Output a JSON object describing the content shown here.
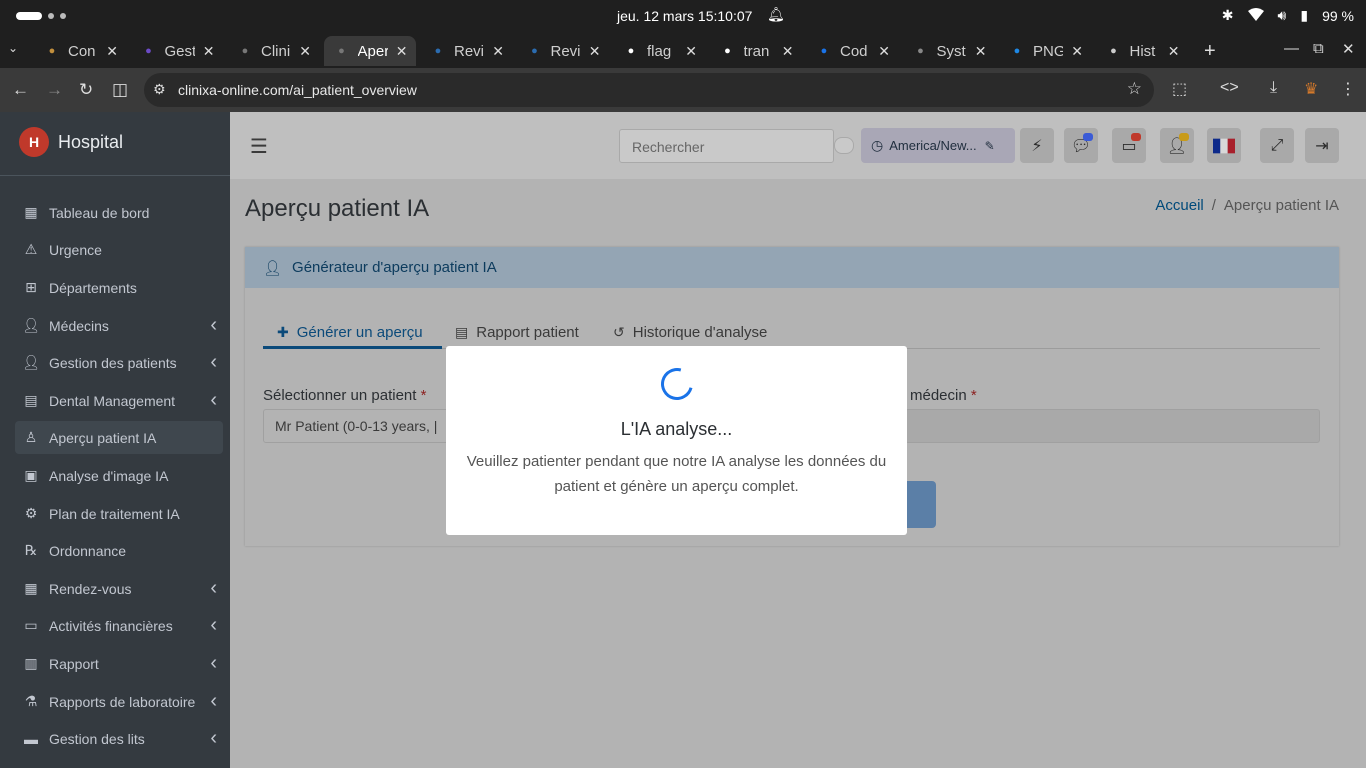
{
  "os": {
    "datetime": "jeu. 12 mars 15:10:07",
    "battery": "99 %"
  },
  "browser": {
    "tabs": [
      {
        "label": "Con",
        "icon": "app-icon",
        "color": "#c28f3d"
      },
      {
        "label": "Gest",
        "icon": "hub-icon",
        "color": "#6c4bc7"
      },
      {
        "label": "Clini",
        "icon": "globe-icon",
        "color": "#777777"
      },
      {
        "label": "Aper",
        "icon": "globe-icon",
        "color": "#777777",
        "active": true
      },
      {
        "label": "Revi",
        "icon": "search-icon",
        "color": "#2b6cb0"
      },
      {
        "label": "Revi",
        "icon": "search-icon",
        "color": "#2b6cb0"
      },
      {
        "label": "flag",
        "icon": "google-icon",
        "color": "#ffffff"
      },
      {
        "label": "tran",
        "icon": "google-icon",
        "color": "#ffffff"
      },
      {
        "label": "Cod",
        "icon": "code-icon",
        "color": "#1a73e8"
      },
      {
        "label": "Syst",
        "icon": "openai-icon",
        "color": "#888888"
      },
      {
        "label": "PNG",
        "icon": "f-icon",
        "color": "#1e88e5"
      },
      {
        "label": "Hist",
        "icon": "history-icon",
        "color": "#cccccc"
      }
    ],
    "url": "clinixa-online.com/ai_patient_overview"
  },
  "sidebar": {
    "brand": "Hospital",
    "items": [
      {
        "label": "Tableau de bord",
        "icon": "grid-icon",
        "chevron": false
      },
      {
        "label": "Urgence",
        "icon": "warning-icon",
        "chevron": false
      },
      {
        "label": "Départements",
        "icon": "sitemap-icon",
        "chevron": false
      },
      {
        "label": "Médecins",
        "icon": "doctor-icon",
        "chevron": true
      },
      {
        "label": "Gestion des patients",
        "icon": "user-icon",
        "chevron": true
      },
      {
        "label": "Dental Management",
        "icon": "table-icon",
        "chevron": true
      },
      {
        "label": "Aperçu patient IA",
        "icon": "user-outline-icon",
        "chevron": false,
        "active": true
      },
      {
        "label": "Analyse d'image IA",
        "icon": "image-icon",
        "chevron": false
      },
      {
        "label": "Plan de traitement IA",
        "icon": "robot-icon",
        "chevron": false
      },
      {
        "label": "Ordonnance",
        "icon": "prescription-icon",
        "chevron": false
      },
      {
        "label": "Rendez-vous",
        "icon": "calendar-icon",
        "chevron": true
      },
      {
        "label": "Activités financières",
        "icon": "money-icon",
        "chevron": true
      },
      {
        "label": "Rapport",
        "icon": "report-icon",
        "chevron": true
      },
      {
        "label": "Rapports de laboratoire",
        "icon": "flask-icon",
        "chevron": true
      },
      {
        "label": "Gestion des lits",
        "icon": "bed-icon",
        "chevron": true
      }
    ]
  },
  "navbar": {
    "search_placeholder": "Rechercher",
    "timezone": "America/New..."
  },
  "page": {
    "title": "Aperçu patient IA",
    "breadcrumb_home": "Accueil",
    "breadcrumb_sep": "/",
    "breadcrumb_current": "Aperçu patient IA"
  },
  "card": {
    "header": "Générateur d'aperçu patient IA",
    "tabs": [
      {
        "label": "Générer un aperçu",
        "icon": "plus-icon",
        "active": true
      },
      {
        "label": "Rapport patient",
        "icon": "file-icon"
      },
      {
        "label": "Historique d'analyse",
        "icon": "history-icon"
      }
    ],
    "patient_label": "Sélectionner un patient",
    "patient_value": "Mr Patient (0-0-13 years, |",
    "doctor_label": "médecin",
    "required_mark": "*"
  },
  "modal": {
    "title": "L'IA analyse...",
    "text": "Veuillez patienter pendant que notre IA analyse les données du patient et génère un aperçu complet."
  }
}
